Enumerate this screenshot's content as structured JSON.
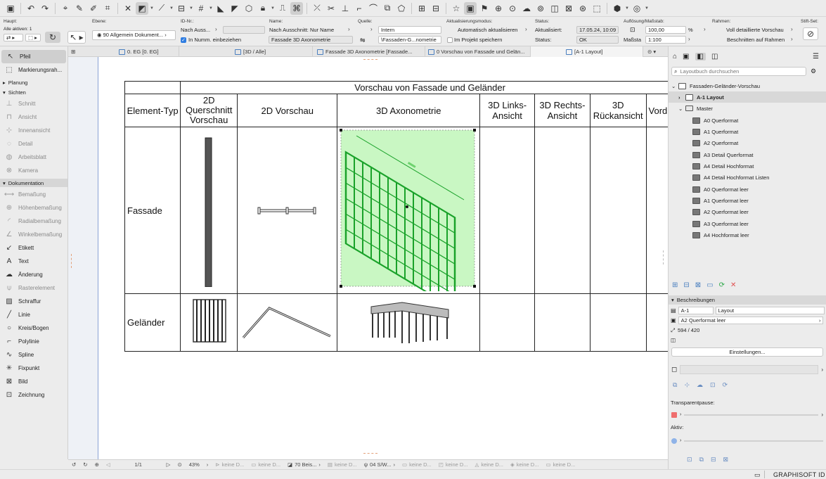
{
  "infobar": {
    "haupt_label": "Haupt:",
    "alle_aktiven": "Alle aktiven: 1",
    "ebene_label": "Ebene:",
    "ebene_value": "90 Allgemein Dokument...",
    "idnr_label": "ID-Nr.:",
    "nach_ausschnitt": "Nach Auss...",
    "in_numm": "In Numm. einbeziehen",
    "name_label": "Name:",
    "name_dropdown": "Nach Ausschnitt: Nur Name",
    "name_value": "Fassade 3D Axonometrie",
    "quelle_label": "Quelle:",
    "quelle_value": "Intern",
    "quelle_path": "\\Fassaden-G...nometrie",
    "aktualisierung_label": "Aktualisierungsmodus:",
    "aktualisierung_value": "Automatisch aktualisieren",
    "im_projekt": "Im Projekt speichern",
    "status_label": "Status:",
    "aktualisiert_label": "Aktualisiert:",
    "aktualisiert_value": "17.05.24, 10:09",
    "status2_label": "Status:",
    "status2_value": "OK",
    "aufloesung_label": "Auflösung/Maßstab:",
    "aufloesung_value": "100,00",
    "percent": "%",
    "massstab_label": "Maßsta",
    "massstab_value": "1:100",
    "rahmen_label": "Rahmen:",
    "rahmen_value": "Voll detaillierte Vorschau",
    "beschnitten": "Beschnitten auf Rahmen",
    "stiftset_label": "Stift-Set:"
  },
  "tabs": [
    {
      "label": "0. EG [0. EG]"
    },
    {
      "label": "[3D / Alle]"
    },
    {
      "label": "Fassade 3D Axonometrie [Fassade..."
    },
    {
      "label": "0 Vorschau von Fassade und Gelän..."
    },
    {
      "label": "[A-1 Layout]"
    }
  ],
  "toolbox": {
    "pfeil": "Pfeil",
    "markierung": "Markierungsrah...",
    "planung": "Planung",
    "sichten": "Sichten",
    "schnitt": "Schnitt",
    "ansicht": "Ansicht",
    "innenansicht": "Innenansicht",
    "detail": "Detail",
    "arbeitsblatt": "Arbeitsblatt",
    "kamera": "Kamera",
    "dokumentation": "Dokumentation",
    "bemassung": "Bemaßung",
    "hoehenbemassung": "Höhenbemaßung",
    "radialbemassung": "Radialbemaßung",
    "winkelbemassung": "Winkelbemaßung",
    "etikett": "Etikett",
    "text": "Text",
    "aenderung": "Änderung",
    "rasterelement": "Rasterelement",
    "schraffur": "Schraffur",
    "linie": "Linie",
    "kreisbogen": "Kreis/Bogen",
    "polylinie": "Polylinie",
    "spline": "Spline",
    "fixpunkt": "Fixpunkt",
    "bild": "Bild",
    "zeichnung": "Zeichnung"
  },
  "sheet": {
    "title": "Vorschau von Fassade und Geländer",
    "headers": [
      "Element-Typ",
      "2D Querschnitt Vorschau",
      "2D Vorschau",
      "3D Axonometrie",
      "3D Links-Ansicht",
      "3D Rechts-Ansicht",
      "3D Rückansicht",
      "Vord"
    ],
    "rows": [
      "Fassade",
      "Geländer"
    ]
  },
  "statusbar": {
    "page": "1/1",
    "zoom": "43%",
    "keine1": "keine D...",
    "keine2": "keine D...",
    "beis": "70 Beis...",
    "keine3": "keine D...",
    "sw": "04 S/W...",
    "keine4": "keine D...",
    "keine5": "keine D...",
    "keine6": "keine D...",
    "keine7": "keine D...",
    "keine8": "keine D..."
  },
  "navigator": {
    "search_placeholder": "Layoutbuch durchsuchen",
    "root": "Fassaden-Geländer-Vorschau",
    "layout": "A-1 Layout",
    "master": "Master",
    "masters": [
      "A0 Querformat",
      "A1 Querformat",
      "A2 Querformat",
      "A3 Detail Querformat",
      "A4 Detail Hochformat",
      "A4 Detail Hochformat Listen",
      "A0 Querformat leer",
      "A1 Querformat leer",
      "A2 Querformat leer",
      "A3 Querformat leer",
      "A4 Hochformat leer"
    ],
    "beschreibungen": "Beschreibungen",
    "id": "A-1",
    "id_name": "Layout",
    "master_value": "A2 Querformat leer",
    "size": "594 / 420",
    "einstellungen": "Einstellungen...",
    "transparent": "Transparentpause:",
    "aktiv": "Aktiv:"
  },
  "bottombar": {
    "brand": "GRAPHISOFT ID"
  },
  "colors": {
    "accent": "#2f7de1",
    "selection_green": "#c9f7c3",
    "facade_green": "#1aa22a"
  }
}
